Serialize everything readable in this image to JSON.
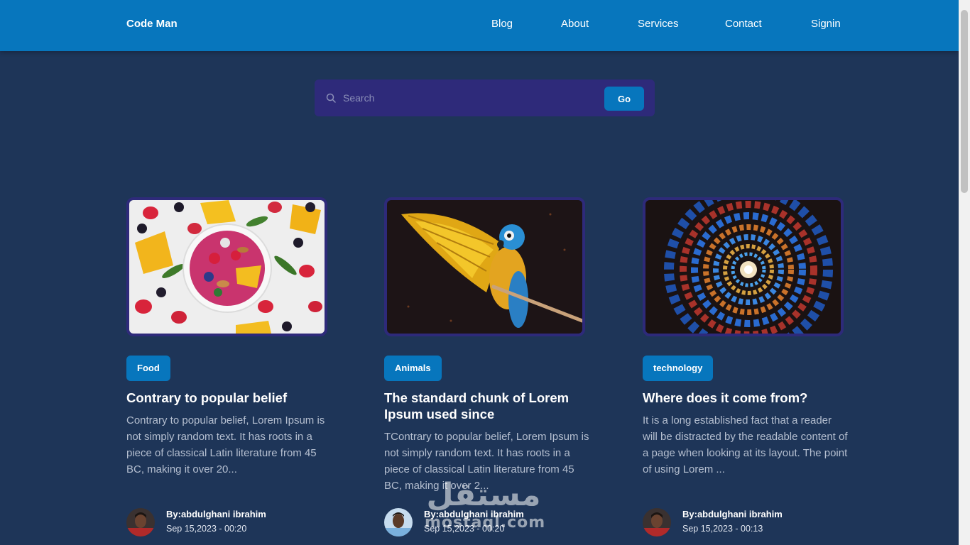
{
  "navbar": {
    "brand": "Code Man",
    "links": [
      "Blog",
      "About",
      "Services",
      "Contact",
      "Signin"
    ],
    "color": "#0776bd"
  },
  "search": {
    "placeholder": "Search",
    "button_label": "Go",
    "icon": "search-icon"
  },
  "posts": [
    {
      "category": "Food",
      "title": "Contrary to popular belief",
      "excerpt": "Contrary to popular belief, Lorem Ipsum is not simply random text. It has roots in a piece of classical Latin literature from 45 BC, making it over 20...",
      "author": "By:abdulghani ibrahim",
      "date": "Sep 15,2023 - 00:20"
    },
    {
      "category": "Animals",
      "title": "The standard chunk of Lorem Ipsum used since",
      "excerpt": "TContrary to popular belief, Lorem Ipsum is not simply random text. It has roots in a piece of classical Latin literature from 45 BC, making it over 2...",
      "author": "By:abdulghani ibrahim",
      "date": "Sep 15,2023 - 00:20"
    },
    {
      "category": "technology",
      "title": "Where does it come from?",
      "excerpt": "It is a long established fact that a reader will be distracted by the readable content of a page when looking at its layout. The point of using Lorem ...",
      "author": "By:abdulghani ibrahim",
      "date": "Sep 15,2023 - 00:13"
    }
  ],
  "watermark": {
    "arabic": "مستقل",
    "latin": "mostaql.com"
  },
  "colors": {
    "background": "#1e3558",
    "accent": "#0776bd",
    "search_bg": "#2e2a7a"
  }
}
